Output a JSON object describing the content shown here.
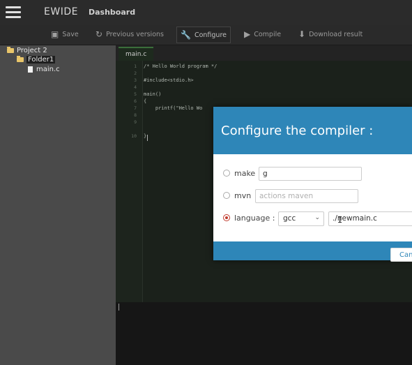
{
  "app": {
    "brand": "EWIDE",
    "nav_dashboard": "Dashboard"
  },
  "toolbar": {
    "save": "Save",
    "previous_versions": "Previous versions",
    "configure": "Configure",
    "compile": "Compile",
    "download_result": "Download result"
  },
  "tree": {
    "project": "Project 2",
    "folder": "Folder1",
    "file": "main.c"
  },
  "editor": {
    "tab": "main.c",
    "line_numbers": [
      "1",
      "2",
      "3",
      "4",
      "5",
      "6",
      "7",
      "8",
      "9",
      "10"
    ],
    "lines": [
      "/* Hello World program */",
      "",
      "#include<stdio.h>",
      "",
      "main()",
      "{",
      "    printf(\"Hello Wo",
      "",
      "",
      "}"
    ]
  },
  "modal": {
    "title": "Configure the compiler :",
    "make_label": "make",
    "make_value": "g",
    "mvn_label": "mvn",
    "mvn_placeholder": "actions maven",
    "language_label": "language :",
    "language_selected": "gcc",
    "file_value": "./newmain.c",
    "cancel_label": "Cancel",
    "selected_option": "language"
  },
  "colors": {
    "modal_header": "#2e86b8",
    "radio_selected": "#c0392b",
    "folder": "#e8c56a"
  }
}
